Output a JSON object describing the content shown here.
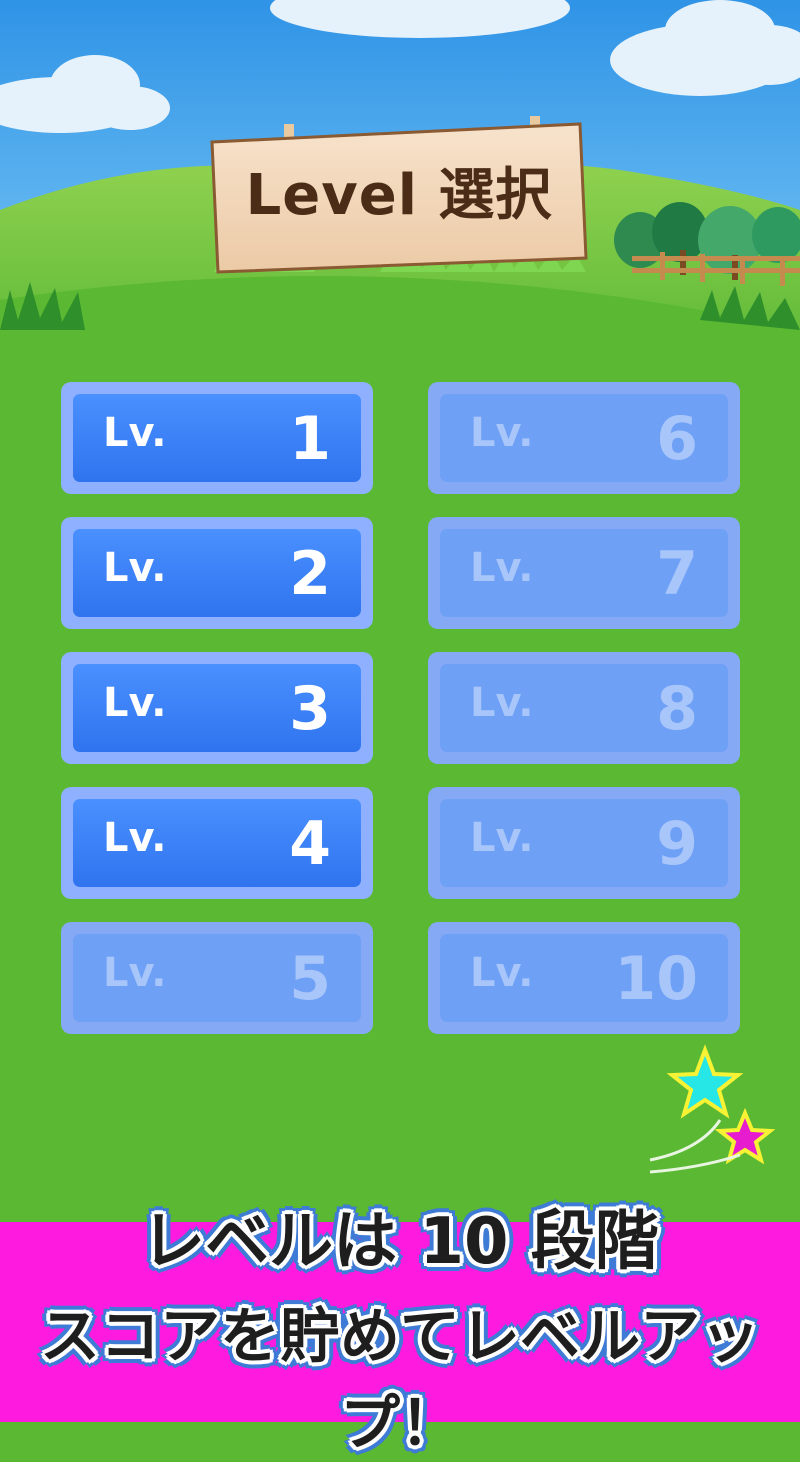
{
  "title": "Level 選択",
  "levels": [
    {
      "prefix": "Lv.",
      "number": "1",
      "unlocked": true
    },
    {
      "prefix": "Lv.",
      "number": "2",
      "unlocked": true
    },
    {
      "prefix": "Lv.",
      "number": "3",
      "unlocked": true
    },
    {
      "prefix": "Lv.",
      "number": "4",
      "unlocked": true
    },
    {
      "prefix": "Lv.",
      "number": "5",
      "unlocked": false
    },
    {
      "prefix": "Lv.",
      "number": "6",
      "unlocked": false
    },
    {
      "prefix": "Lv.",
      "number": "7",
      "unlocked": false
    },
    {
      "prefix": "Lv.",
      "number": "8",
      "unlocked": false
    },
    {
      "prefix": "Lv.",
      "number": "9",
      "unlocked": false
    },
    {
      "prefix": "Lv.",
      "number": "10",
      "unlocked": false
    }
  ],
  "promo": {
    "line1": "レベルは 10 段階",
    "line2": "スコアを貯めてレベルアップ！"
  },
  "colors": {
    "sky": "#3aa0ec",
    "grass": "#5ab833",
    "button_active": "#3a82f5",
    "button_locked": "#6ea0f6",
    "banner": "#ff1adf",
    "star_cyan": "#27e6e6",
    "star_magenta": "#e81ccf"
  }
}
